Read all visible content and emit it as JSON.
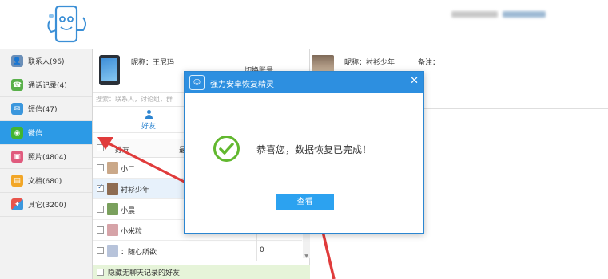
{
  "header": {
    "account_blur": [
      "",
      ""
    ]
  },
  "sidebar": {
    "items": [
      {
        "label": "联系人(96)",
        "icon": "contacts-icon",
        "color": "#6b8fb8"
      },
      {
        "label": "通话记录(4)",
        "icon": "phone-icon",
        "color": "#59b04a"
      },
      {
        "label": "短信(47)",
        "icon": "sms-icon",
        "color": "#3b97dd"
      },
      {
        "label": "微信",
        "icon": "wechat-icon",
        "color": "#42b531",
        "active": true
      },
      {
        "label": "照片(4804)",
        "icon": "photo-icon",
        "color": "#e05b7e"
      },
      {
        "label": "文档(680)",
        "icon": "document-icon",
        "color": "#f2a626"
      },
      {
        "label": "其它(3200)",
        "icon": "other-icon",
        "color": "#e8544b"
      }
    ]
  },
  "contact_panel": {
    "nickname": "昵称：王尼玛",
    "switch": "切换账号",
    "search_placeholder": "搜索：联系人，讨论组，群",
    "tab_friends": "好友",
    "header_name": "好友",
    "header_col2": "最",
    "rows": [
      {
        "name": "小二",
        "count": "",
        "checked": false,
        "selected": false,
        "avatar": "#caa889"
      },
      {
        "name": "衬衫少年",
        "count": "",
        "checked": true,
        "selected": true,
        "avatar": "#8e6c52"
      },
      {
        "name": "小晨",
        "count": "",
        "checked": false,
        "selected": false,
        "avatar": "#7aa05d"
      },
      {
        "name": "小米粒",
        "count": "",
        "checked": false,
        "selected": false,
        "avatar": "#d6a3a8"
      },
      {
        "name": "：随心所欲",
        "count": "0",
        "checked": false,
        "selected": false,
        "avatar": "#b7c3da"
      }
    ],
    "hide_label": "隐藏无聊天记录的好友"
  },
  "detail": {
    "nickname": "昵称：衬衫少年",
    "note": "备注："
  },
  "dialog": {
    "title": "强力安卓恢复精灵",
    "close": "✕",
    "message": "恭喜您，数据恢复已完成！",
    "button": "查看"
  },
  "colors": {
    "accent": "#2c9ae6",
    "dialog_title": "#2d8fe0",
    "success": "#62b82f",
    "arrow": "#e03b3b"
  }
}
